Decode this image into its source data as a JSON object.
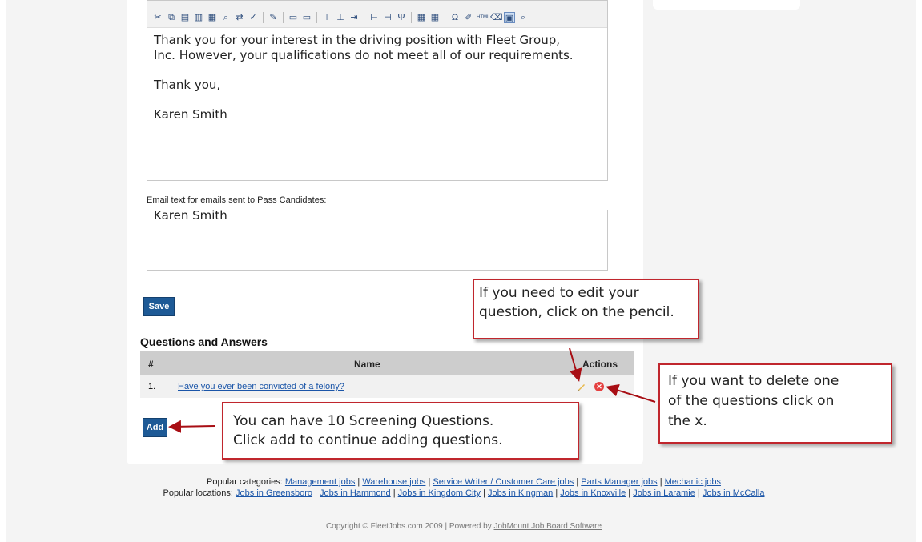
{
  "editor": {
    "paragraphs": [
      "Thank you for your interest in the driving position with Fleet Group,",
      "Inc. However, your qualifications do not meet all of our requirements.",
      "Thank you,",
      "Karen Smith"
    ]
  },
  "pass_section": {
    "label": "Email text for emails sent to Pass Candidates:",
    "text": "Karen Smith"
  },
  "buttons": {
    "save": "Save",
    "add": "Add"
  },
  "qa": {
    "title": "Questions and Answers",
    "columns": {
      "num": "#",
      "name": "Name",
      "actions": "Actions"
    },
    "rows": [
      {
        "num": "1.",
        "question": "Have you ever been convicted of a felony?"
      }
    ]
  },
  "callouts": {
    "edit": [
      "If you need to edit your",
      "question, click on the pencil."
    ],
    "delete": [
      "If you want to delete one",
      "of the questions click on",
      "the x."
    ],
    "add": [
      "You can have 10 Screening Questions.",
      "Click add to continue adding questions."
    ]
  },
  "footer": {
    "categories_label": "Popular categories:",
    "categories": [
      "Management jobs",
      "Warehouse jobs",
      "Service Writer / Customer Care jobs",
      "Parts Manager jobs",
      "Mechanic jobs"
    ],
    "locations_label": "Popular locations:",
    "locations": [
      "Jobs in Greensboro",
      "Jobs in Hammond",
      "Jobs in Kingdom City",
      "Jobs in Kingman",
      "Jobs in Knoxville",
      "Jobs in Laramie",
      "Jobs in McCalla"
    ],
    "copyright": "Copyright © FleetJobs.com 2009",
    "separator": "|",
    "powered_label": "Powered by",
    "powered_link": "JobMount Job Board Software"
  },
  "colors": {
    "accent": "#1e5a96",
    "callout_border": "#c0262d",
    "link": "#1a55a8"
  }
}
